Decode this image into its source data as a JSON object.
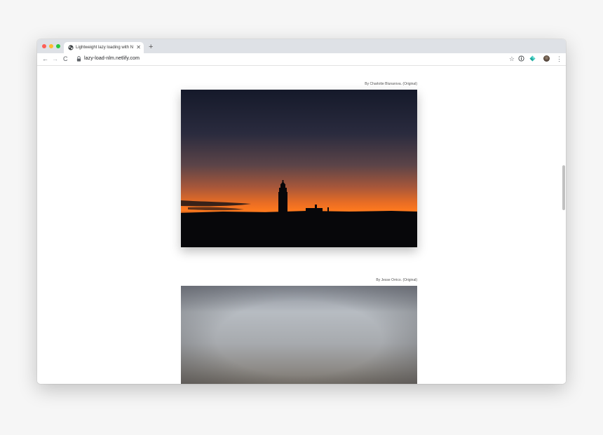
{
  "browser": {
    "tab": {
      "title": "Lightweight lazy loading with N",
      "close_glyph": "✕"
    },
    "new_tab_glyph": "+",
    "nav": {
      "back_glyph": "←",
      "forward_glyph": "→",
      "reload_glyph": "C"
    },
    "address_bar": {
      "url": "lazy-load-nlm.netlify.com",
      "star_glyph": "☆"
    },
    "menu_glyph": "⋮",
    "icons": [
      "globe-icon",
      "lock-icon",
      "star-icon",
      "info-extension-icon",
      "diamond-extension-icon",
      "avatar",
      "more-menu-icon"
    ]
  },
  "content": {
    "photos": [
      {
        "credit": "By Charlotte Blunarova. (Original)",
        "state": "loaded"
      },
      {
        "credit": "By Jesse Orrico. (Original)",
        "state": "placeholder-blurred"
      }
    ]
  },
  "colors": {
    "traffic_close": "#fd5f57",
    "traffic_minimize": "#febc2e",
    "traffic_maximize": "#28c840",
    "tabbar_bg": "#dee1e6",
    "sky_top": "#15192a",
    "sky_horizon": "#ff7a1e",
    "extension_accent": "#2cc2b5"
  }
}
